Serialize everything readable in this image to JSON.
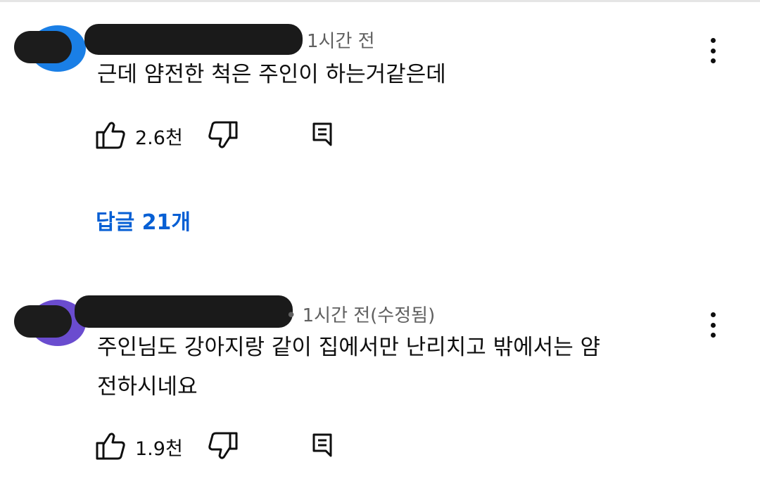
{
  "comments": [
    {
      "time": "1시간 전",
      "text": "근데 얌전한 척은 주인이 하는거같은데",
      "likes": "2.6천",
      "avatar_color": "#1a7fe6",
      "replies_label": "답글 21개"
    },
    {
      "time": "• 1시간 전(수정됨)",
      "text": "주인님도 강아지랑 같이 집에서만 난리치고 밖에서는 얌전하시네요",
      "likes": "1.9천",
      "avatar_color": "#6a4ccf"
    }
  ],
  "icons": {
    "like": "thumbs-up-icon",
    "dislike": "thumbs-down-icon",
    "reply": "reply-comment-icon",
    "more": "more-vertical-icon"
  }
}
